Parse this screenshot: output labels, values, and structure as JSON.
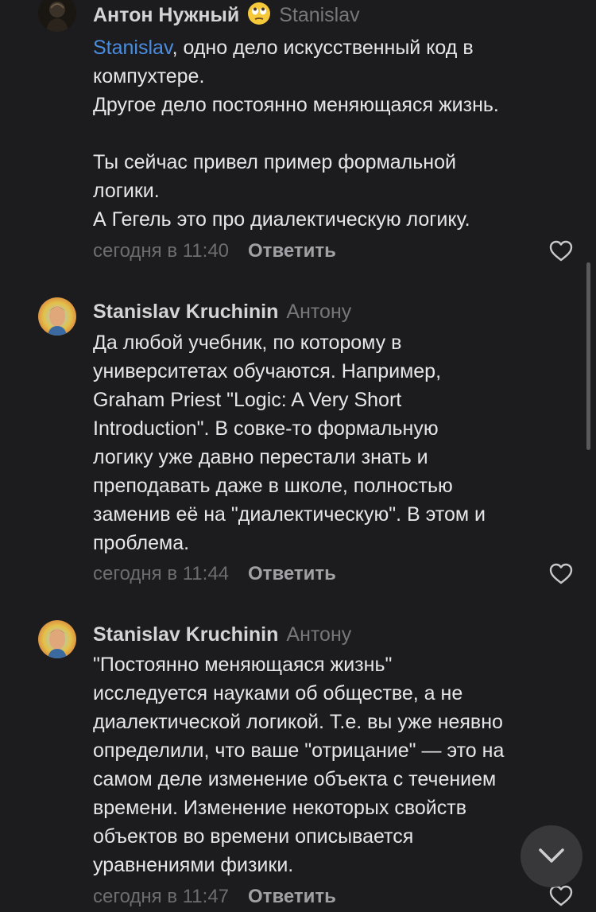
{
  "comments": [
    {
      "author": "Антон Нужный",
      "emoji": "🙄",
      "reply_to": "Stanislav",
      "mention": "Stanislav",
      "lines": {
        "l1_rest": ", одно дело искусственный код в",
        "l2": "компухтере.",
        "l3": "Другое дело постоянно меняющаяся жизнь.",
        "l4": "Ты сейчас привел пример формальной",
        "l5": "логики.",
        "l6": "А Гегель это про диалектическую логику."
      },
      "time": "сегодня в 11:40",
      "reply_label": "Ответить"
    },
    {
      "author": "Stanislav Kruchinin",
      "reply_to": "Антону",
      "lines": {
        "l1": "Да любой учебник, по которому в",
        "l2": "университетах обучаются. Например,",
        "l3": "Graham Priest \"Logic: A Very Short",
        "l4": "Introduction\". В совке-то формальную",
        "l5": "логику уже давно перестали знать и",
        "l6": "преподавать даже в школе, полностью",
        "l7": "заменив её на \"диалектическую\". В этом и",
        "l8": "проблема."
      },
      "time": "сегодня в 11:44",
      "reply_label": "Ответить"
    },
    {
      "author": "Stanislav Kruchinin",
      "reply_to": "Антону",
      "lines": {
        "l1": "\"Постоянно меняющаяся жизнь\"",
        "l2": "исследуется науками об обществе, а не",
        "l3": "диалектической логикой. Т.е. вы уже неявно",
        "l4": "определили, что ваше \"отрицание\" — это на",
        "l5": "самом деле изменение объекта с течением",
        "l6": "времени. Изменение некоторых свойств",
        "l7": "объектов во времени описывается",
        "l8": "уравнениями физики."
      },
      "time": "сегодня в 11:47",
      "reply_label": "Ответить"
    }
  ],
  "icons": {
    "like": "heart-outline-icon",
    "scroll_down": "chevron-down-icon"
  },
  "colors": {
    "background": "#1c1c1e",
    "mention": "#4a8de0",
    "text": "#e6e6e8"
  }
}
